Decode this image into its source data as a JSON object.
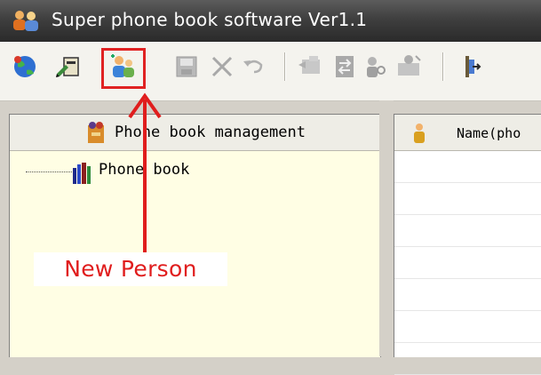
{
  "window": {
    "title": "Super phone book software Ver1.1"
  },
  "toolbar": {
    "buttons": [
      {
        "name": "globe-icon",
        "enabled": true
      },
      {
        "name": "book-edit-icon",
        "enabled": true
      },
      {
        "name": "new-person-icon",
        "enabled": true
      },
      {
        "name": "save-icon",
        "enabled": false
      },
      {
        "name": "delete-icon",
        "enabled": false
      },
      {
        "name": "undo-icon",
        "enabled": false
      },
      {
        "name": "import-icon",
        "enabled": false
      },
      {
        "name": "transfer-icon",
        "enabled": false
      },
      {
        "name": "person-find-icon",
        "enabled": false
      },
      {
        "name": "person-card-icon",
        "enabled": false
      },
      {
        "name": "exit-icon",
        "enabled": true
      }
    ]
  },
  "left_panel": {
    "header": "Phone book management",
    "tree": [
      {
        "label": "Phone book"
      }
    ]
  },
  "right_panel": {
    "column_header": "Name(pho"
  },
  "annotation": {
    "label": "New Person",
    "color": "#e01d1d"
  }
}
